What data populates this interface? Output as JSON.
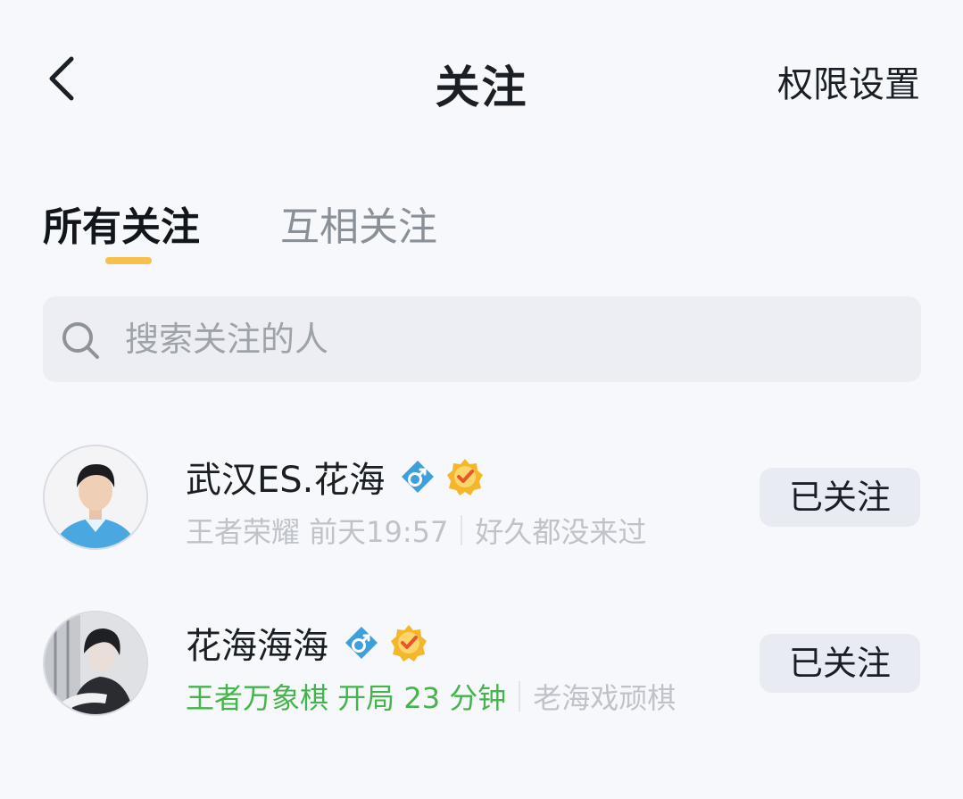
{
  "header": {
    "title": "关注",
    "right_action": "权限设置"
  },
  "tabs": [
    {
      "label": "所有关注",
      "active": true
    },
    {
      "label": "互相关注",
      "active": false
    }
  ],
  "search": {
    "placeholder": "搜索关注的人"
  },
  "colors": {
    "accent": "#f5c04b",
    "online_green": "#44b54a",
    "gender_blue": "#3e9fdb",
    "verified_gold": "#f4b62a"
  },
  "follows": [
    {
      "name": "武汉ES.花海",
      "gender_icon": "male-icon",
      "verified_icon": "verified-badge-icon",
      "status": "王者荣耀 前天19:57",
      "status_online": false,
      "signature": "好久都没来过",
      "button": "已关注"
    },
    {
      "name": "花海海海",
      "gender_icon": "male-icon",
      "verified_icon": "verified-badge-icon",
      "status": "王者万象棋 开局 23 分钟",
      "status_online": true,
      "signature": "老海戏顽棋",
      "button": "已关注"
    }
  ]
}
